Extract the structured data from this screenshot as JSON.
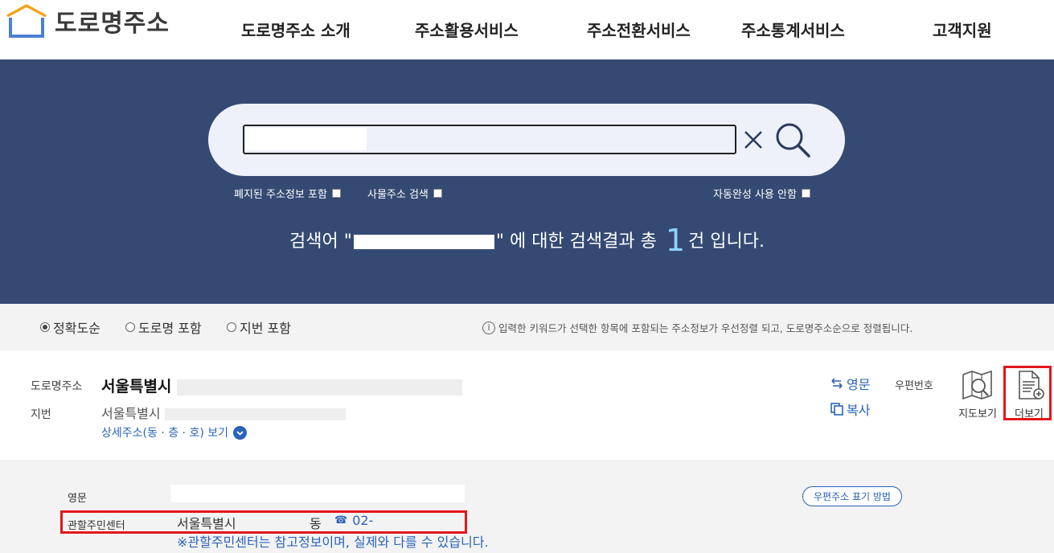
{
  "header": {
    "logo_text": "도로명주소",
    "nav": [
      "도로명주소 소개",
      "주소활용서비스",
      "주소전환서비스",
      "주소통계서비스",
      "고객지원"
    ]
  },
  "search": {
    "options": {
      "include_abolished": "폐지된 주소정보 포함",
      "object_address": "사물주소 검색",
      "autocomplete_off": "자동완성 사용 안함"
    },
    "result_prefix": "검색어 \"",
    "result_mid": "\" 에 대한 검색결과 총 ",
    "result_count": "1",
    "result_suffix": "건 입니다."
  },
  "sort": {
    "options": [
      "정확도순",
      "도로명 포함",
      "지번 포함"
    ],
    "selected": "정확도순",
    "note": "입력한 키워드가 선택한 항목에 포함되는 주소정보가 우선정렬 되고, 도로명주소순으로 정렬됩니다."
  },
  "result": {
    "road_label": "도로명주소",
    "jibun_label": "지번",
    "road_address": "서울특별시",
    "jibun_address": "서울특별시",
    "detail_link": "상세주소(동 · 층 · 호) 보기",
    "english_btn": "영문",
    "copy_btn": "복사",
    "postal_label": "우편번호",
    "map_btn": "지도보기",
    "more_btn": "더보기"
  },
  "detail": {
    "english_label": "영문",
    "center_label": "관할주민센터",
    "center_city": "서울특별시",
    "center_dong": "동",
    "phone": "02-",
    "note": "※관할주민센터는 참고정보이며, 실제와 다를 수 있습니다.",
    "postal_method_btn": "우편주소 표기 방법"
  },
  "colors": {
    "hero_bg": "#354a73",
    "link_blue": "#2a63b8",
    "highlight_red": "#e3161b",
    "count_cyan": "#8fd3ff"
  }
}
